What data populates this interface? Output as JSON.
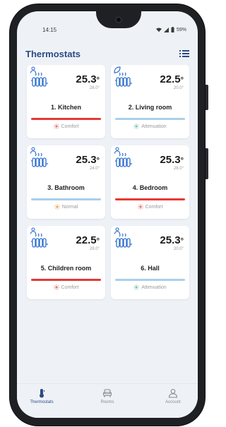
{
  "status": {
    "time": "14:15",
    "battery": "59%"
  },
  "header": {
    "title": "Thermostats"
  },
  "cards": [
    {
      "name": "1. Kitchen",
      "temp_int": "25.3",
      "temp_unit": "°",
      "target": "28.0°",
      "mode": "Comfort",
      "bar_color": "#e53935",
      "mode_color": "#e57373",
      "badge": "person"
    },
    {
      "name": "2. Living room",
      "temp_int": "22.5",
      "temp_unit": "°",
      "target": "20.0°",
      "mode": "Attenuation",
      "bar_color": "#a9cfea",
      "mode_color": "#7cc3a0",
      "badge": "leaf"
    },
    {
      "name": "3. Bathroom",
      "temp_int": "25.3",
      "temp_unit": "°",
      "target": "24.0°",
      "mode": "Normal",
      "bar_color": "#a9cfea",
      "mode_color": "#f0a35c",
      "badge": "person"
    },
    {
      "name": "4. Bedroom",
      "temp_int": "25.3",
      "temp_unit": "°",
      "target": "28.0°",
      "mode": "Comfort",
      "bar_color": "#e53935",
      "mode_color": "#e57373",
      "badge": "person"
    },
    {
      "name": "5. Children room",
      "temp_int": "22.5",
      "temp_unit": "°",
      "target": "28.0°",
      "mode": "Comfort",
      "bar_color": "#e53935",
      "mode_color": "#e57373",
      "badge": "person"
    },
    {
      "name": "6. Hall",
      "temp_int": "25.3",
      "temp_unit": "°",
      "target": "20.0°",
      "mode": "Attenuation",
      "bar_color": "#a9cfea",
      "mode_color": "#7cc3a0",
      "badge": "person"
    }
  ],
  "nav": {
    "thermostats": "Thermostats",
    "rooms": "Rooms",
    "account": "Account"
  },
  "colors": {
    "accent": "#2c4a85",
    "radiator": "#2f6fd0"
  }
}
